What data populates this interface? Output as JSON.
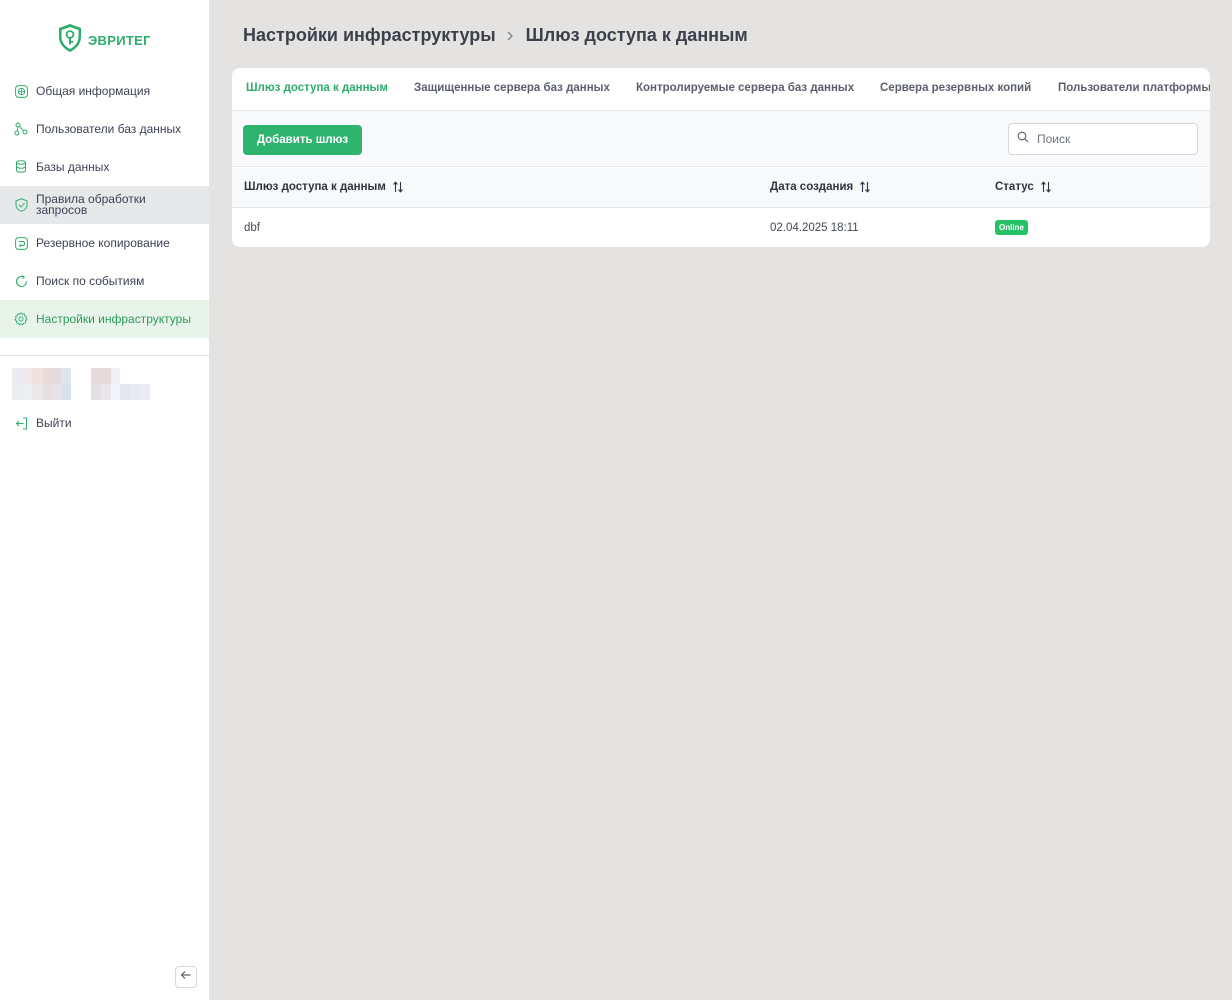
{
  "app": {
    "logo_text": "ЭВРИТЕГ",
    "brand_color": "#2eac6a"
  },
  "sidebar": {
    "items": [
      {
        "label": "Общая информация",
        "icon": "globe-icon"
      },
      {
        "label": "Пользователи баз данных",
        "icon": "users-network-icon"
      },
      {
        "label": "Базы данных",
        "icon": "database-icon"
      },
      {
        "label_line1": "Правила обработки",
        "label_line2": "запросов",
        "icon": "shield-icon"
      },
      {
        "label": "Резервное копирование",
        "icon": "backup-icon"
      },
      {
        "label": "Поиск по событиям",
        "icon": "refresh-search-icon"
      },
      {
        "label": "Настройки инфраструктуры",
        "icon": "gear-icon"
      }
    ],
    "logout_label": "Выйти"
  },
  "breadcrumb": {
    "parent": "Настройки инфраструктуры",
    "current": "Шлюз доступа к данным"
  },
  "tabs": [
    {
      "label": "Шлюз доступа к данным",
      "active": true
    },
    {
      "label": "Защищенные сервера баз данных"
    },
    {
      "label": "Контролируемые сервера баз данных"
    },
    {
      "label": "Сервера резервных копий"
    },
    {
      "label": "Пользователи платформы"
    }
  ],
  "toolbar": {
    "add_label": "Добавить шлюз",
    "search_placeholder": "Поиск"
  },
  "table": {
    "columns": [
      "Шлюз доступа к данным",
      "Дата создания",
      "Статус"
    ],
    "rows": [
      {
        "name": "dbf",
        "created": "02.04.2025 18:11",
        "status": "Online"
      }
    ],
    "status_color": "#27c267"
  }
}
